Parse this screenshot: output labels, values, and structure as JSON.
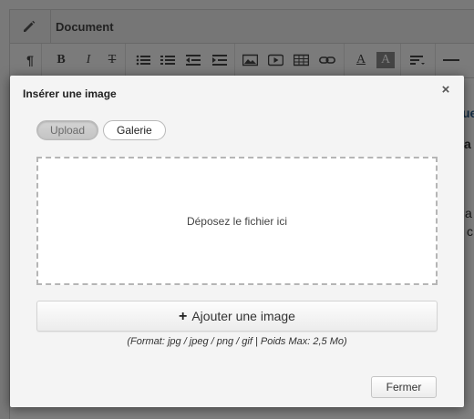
{
  "editor": {
    "title": "Document",
    "toolbar": {
      "paragraph_glyph": "¶",
      "bold_glyph": "B",
      "italic_glyph": "I",
      "strike_glyph": "T",
      "text_color_glyph": "A",
      "highlight_glyph": "A"
    },
    "icons": [
      "pencil-icon",
      "paragraph-icon",
      "bold-icon",
      "italic-icon",
      "strikethrough-icon",
      "unordered-list-icon",
      "ordered-list-icon",
      "outdent-icon",
      "indent-icon",
      "image-icon",
      "video-icon",
      "table-icon",
      "link-icon",
      "text-color-icon",
      "highlight-icon",
      "align-icon",
      "horizontal-rule-icon"
    ],
    "background_fragments": {
      "frag_1": "ue",
      "frag_2": "a",
      "frag_3": "a",
      "frag_4": "l c"
    }
  },
  "modal": {
    "title": "Insérer une image",
    "close_glyph": "×",
    "tabs": [
      {
        "label": "Upload",
        "active": true
      },
      {
        "label": "Galerie",
        "active": false
      }
    ],
    "dropzone_text": "Déposez le fichier ici",
    "add_button": {
      "icon_glyph": "+",
      "label": "Ajouter une image"
    },
    "format_hint": "(Format: jpg / jpeg / png / gif | Poids Max: 2,5 Mo)",
    "close_button_label": "Fermer"
  },
  "colors": {
    "overlay": "rgba(0,0,0,0.5)",
    "modal_bg": "#f4f4f4",
    "dropzone_border": "#b5b5b5",
    "link_blue": "#2a5c8a"
  }
}
